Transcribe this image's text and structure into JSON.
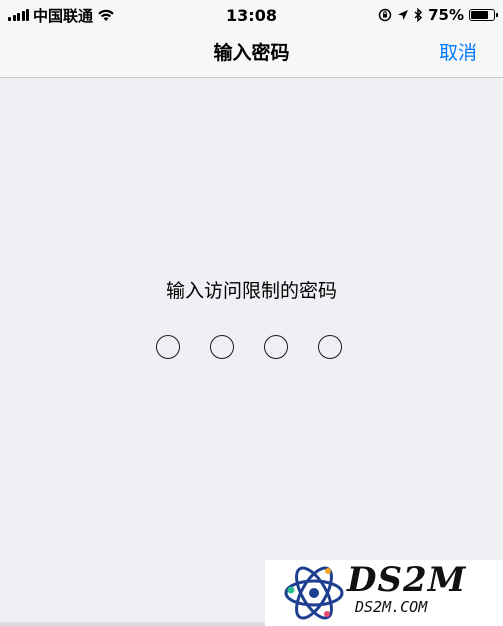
{
  "status_bar": {
    "carrier": "中国联通",
    "time": "13:08",
    "battery_percent": "75%",
    "battery_level": 0.75,
    "icons": [
      "signal-icon",
      "wifi-icon",
      "orientation-lock-icon",
      "location-icon",
      "bluetooth-icon",
      "battery-icon"
    ]
  },
  "nav": {
    "title": "输入密码",
    "cancel_label": "取消"
  },
  "passcode": {
    "prompt": "输入访问限制的密码",
    "digit_count": 4,
    "digits_entered": 0
  },
  "watermark": {
    "title": "DS2M",
    "subtitle": "DS2M.COM"
  },
  "colors": {
    "accent": "#007aff",
    "background": "#efeff4",
    "bar_background": "#f7f7f7",
    "separator": "#c8c7cc"
  }
}
